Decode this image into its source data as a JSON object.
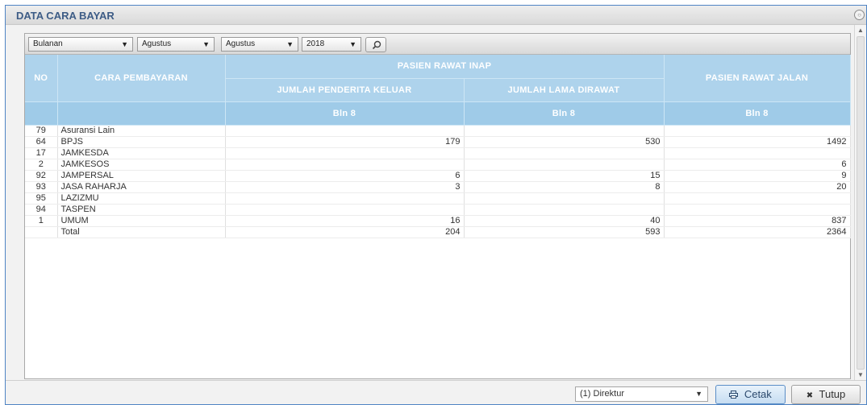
{
  "window": {
    "title": "DATA CARA BAYAR",
    "close_icon": "circle-close-icon"
  },
  "filters": {
    "period_type": "Bulanan",
    "month_from": "Agustus",
    "month_to": "Agustus",
    "year": "2018",
    "dropdown_glyph": "▼",
    "search_icon": "search-icon"
  },
  "table": {
    "headers": {
      "no": "NO",
      "cara": "CARA PEMBAYARAN",
      "rawat_inap": "PASIEN RAWAT INAP",
      "keluar": "JUMLAH PENDERITA KELUAR",
      "lama": "JUMLAH LAMA DIRAWAT",
      "rawat_jalan": "PASIEN RAWAT JALAN",
      "bln1": "Bln 8",
      "bln2": "Bln 8",
      "bln3": "Bln 8"
    },
    "rows": [
      {
        "no": "79",
        "cara": "Asuransi Lain",
        "keluar": "",
        "lama": "",
        "jalan": ""
      },
      {
        "no": "64",
        "cara": "BPJS",
        "keluar": "179",
        "lama": "530",
        "jalan": "1492"
      },
      {
        "no": "17",
        "cara": "JAMKESDA",
        "keluar": "",
        "lama": "",
        "jalan": ""
      },
      {
        "no": "2",
        "cara": "JAMKESOS",
        "keluar": "",
        "lama": "",
        "jalan": "6"
      },
      {
        "no": "92",
        "cara": "JAMPERSAL",
        "keluar": "6",
        "lama": "15",
        "jalan": "9"
      },
      {
        "no": "93",
        "cara": "JASA RAHARJA",
        "keluar": "3",
        "lama": "8",
        "jalan": "20"
      },
      {
        "no": "95",
        "cara": "LAZIZMU",
        "keluar": "",
        "lama": "",
        "jalan": ""
      },
      {
        "no": "94",
        "cara": "TASPEN",
        "keluar": "",
        "lama": "",
        "jalan": ""
      },
      {
        "no": "1",
        "cara": "UMUM",
        "keluar": "16",
        "lama": "40",
        "jalan": "837"
      }
    ],
    "total": {
      "label": "Total",
      "keluar": "204",
      "lama": "593",
      "jalan": "2364"
    }
  },
  "footer": {
    "signer": "(1) Direktur",
    "cetak_label": "Cetak",
    "cetak_icon": "printer-icon",
    "tutup_label": "Tutup",
    "tutup_icon": "close-x-icon"
  },
  "colors": {
    "header_bg": "#aed3ec",
    "title_text": "#3d5c86",
    "window_border": "#4f84c4"
  }
}
